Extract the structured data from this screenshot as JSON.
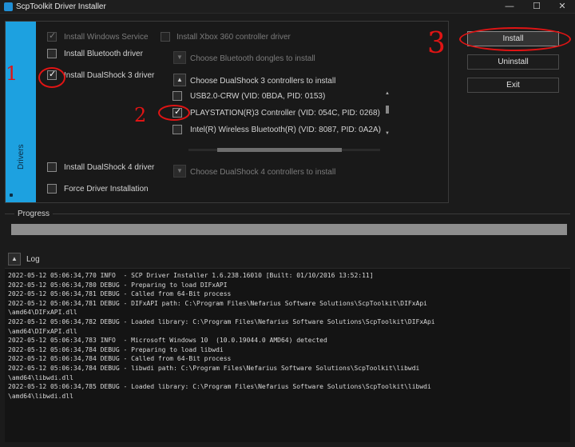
{
  "window": {
    "title": "ScpToolkit Driver Installer",
    "controls": {
      "minimize": "—",
      "maximize": "☐",
      "close": "✕"
    }
  },
  "drivers": {
    "tab_label": "Drivers",
    "windows_service": {
      "label": "Install Windows Service",
      "checked": true,
      "enabled": false
    },
    "xbox360": {
      "label": "Install Xbox 360 controller driver",
      "checked": false,
      "enabled": false
    },
    "bluetooth": {
      "label": "Install Bluetooth driver",
      "checked": false,
      "enabled": true
    },
    "bluetooth_dongles": {
      "label": "Choose Bluetooth dongles to install",
      "enabled": false
    },
    "ds3": {
      "label": "Install DualShock 3 driver",
      "checked": true,
      "enabled": true
    },
    "ds3_controllers": {
      "label": "Choose DualShock 3 controllers to install",
      "items": [
        {
          "label": "USB2.0-CRW (VID: 0BDA, PID: 0153)",
          "checked": false
        },
        {
          "label": "PLAYSTATION(R)3 Controller (VID: 054C, PID: 0268)",
          "checked": true
        },
        {
          "label": "Intel(R) Wireless Bluetooth(R) (VID: 8087, PID: 0A2A)",
          "checked": false
        }
      ]
    },
    "ds4": {
      "label": "Install DualShock 4 driver",
      "checked": false,
      "enabled": true
    },
    "ds4_controllers": {
      "label": "Choose DualShock 4 controllers to install",
      "enabled": false
    },
    "force": {
      "label": "Force Driver Installation",
      "checked": false,
      "enabled": true
    }
  },
  "actions": {
    "install": "Install",
    "uninstall": "Uninstall",
    "exit": "Exit"
  },
  "progress": {
    "label": "Progress",
    "value_percent": 0
  },
  "log": {
    "label": "Log",
    "lines": [
      "2022-05-12 05:06:34,770 INFO  - SCP Driver Installer 1.6.238.16010 [Built: 01/10/2016 13:52:11]",
      "2022-05-12 05:06:34,780 DEBUG - Preparing to load DIFxAPI",
      "2022-05-12 05:06:34,781 DEBUG - Called from 64-Bit process",
      "2022-05-12 05:06:34,781 DEBUG - DIFxAPI path: C:\\Program Files\\Nefarius Software Solutions\\ScpToolkit\\DIFxApi",
      "\\amd64\\DIFxAPI.dll",
      "2022-05-12 05:06:34,782 DEBUG - Loaded library: C:\\Program Files\\Nefarius Software Solutions\\ScpToolkit\\DIFxApi",
      "\\amd64\\DIFxAPI.dll",
      "2022-05-12 05:06:34,783 INFO  - Microsoft Windows 10  (10.0.19044.0 AMD64) detected",
      "2022-05-12 05:06:34,784 DEBUG - Preparing to load libwdi",
      "2022-05-12 05:06:34,784 DEBUG - Called from 64-Bit process",
      "2022-05-12 05:06:34,784 DEBUG - libwdi path: C:\\Program Files\\Nefarius Software Solutions\\ScpToolkit\\libwdi",
      "\\amd64\\libwdi.dll",
      "2022-05-12 05:06:34,785 DEBUG - Loaded library: C:\\Program Files\\Nefarius Software Solutions\\ScpToolkit\\libwdi",
      "\\amd64\\libwdi.dll"
    ]
  },
  "annotations": {
    "step1": "1",
    "step2": "2",
    "step3": "3"
  },
  "colors": {
    "accent": "#1da1e0",
    "annotation": "#e01414"
  }
}
